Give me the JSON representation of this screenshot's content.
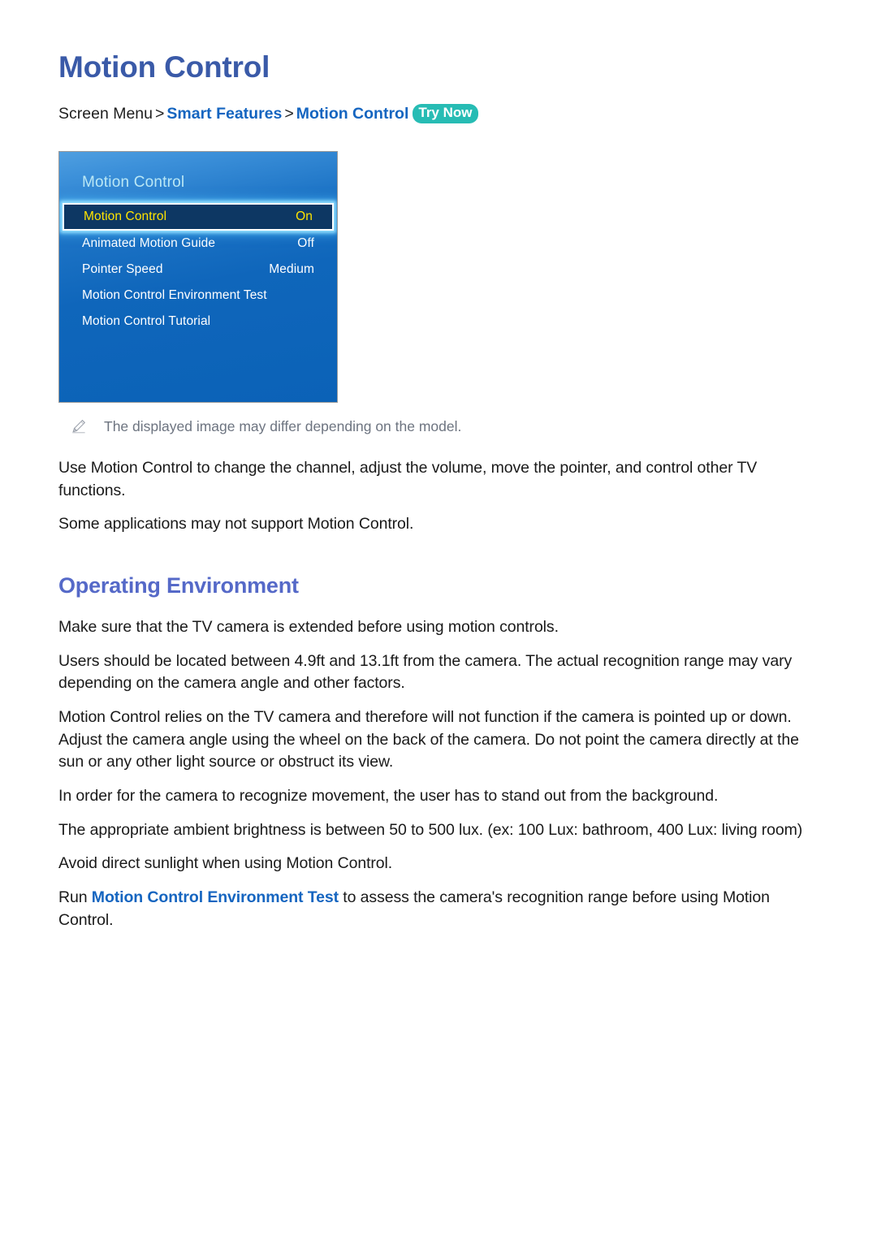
{
  "page": {
    "title": "Motion Control"
  },
  "breadcrumb": {
    "root": "Screen Menu",
    "separator": ">",
    "level1": "Smart Features",
    "level2": "Motion Control",
    "badge": "Try Now"
  },
  "tv_menu": {
    "panel_title": "Motion Control",
    "rows": [
      {
        "label": "Motion Control",
        "value": "On",
        "selected": true
      },
      {
        "label": "Animated Motion Guide",
        "value": "Off",
        "selected": false
      },
      {
        "label": "Pointer Speed",
        "value": "Medium",
        "selected": false
      },
      {
        "label": "Motion Control Environment Test",
        "value": "",
        "selected": false
      },
      {
        "label": "Motion Control Tutorial",
        "value": "",
        "selected": false
      }
    ]
  },
  "note": {
    "icon": "pencil-icon",
    "text": "The displayed image may differ depending on the model."
  },
  "intro": {
    "paragraph1": "Use Motion Control to change the channel, adjust the volume, move the pointer, and control other TV functions.",
    "paragraph2": "Some applications may not support Motion Control."
  },
  "operating_environment": {
    "heading": "Operating Environment",
    "paragraph1": "Make sure that the TV camera is extended before using motion controls.",
    "paragraph2": "Users should be located between 4.9ft and 13.1ft from the camera. The actual recognition range may vary depending on the camera angle and other factors.",
    "paragraph3": "Motion Control relies on the TV camera and therefore will not function if the camera is pointed up or down. Adjust the camera angle using the wheel on the back of the camera. Do not point the camera directly at the sun or any other light source or obstruct its view.",
    "paragraph4": "In order for the camera to recognize movement, the user has to stand out from the background.",
    "paragraph5": "The appropriate ambient brightness is between 50 to 500 lux. (ex: 100 Lux: bathroom, 400 Lux: living room)",
    "paragraph6": "Avoid direct sunlight when using Motion Control.",
    "paragraph7_before": "Run ",
    "paragraph7_link": "Motion Control Environment Test",
    "paragraph7_after": " to assess the camera's recognition range before using Motion Control."
  },
  "colors": {
    "title_blue": "#3a5aa8",
    "heading_blue": "#5569c8",
    "link_blue": "#1565c0",
    "badge_teal": "#27bcb4",
    "menu_blue": "#0f66bb",
    "selected_row_bg": "#0d3763",
    "selected_row_text": "#ffe400",
    "note_gray": "#6d7480"
  }
}
